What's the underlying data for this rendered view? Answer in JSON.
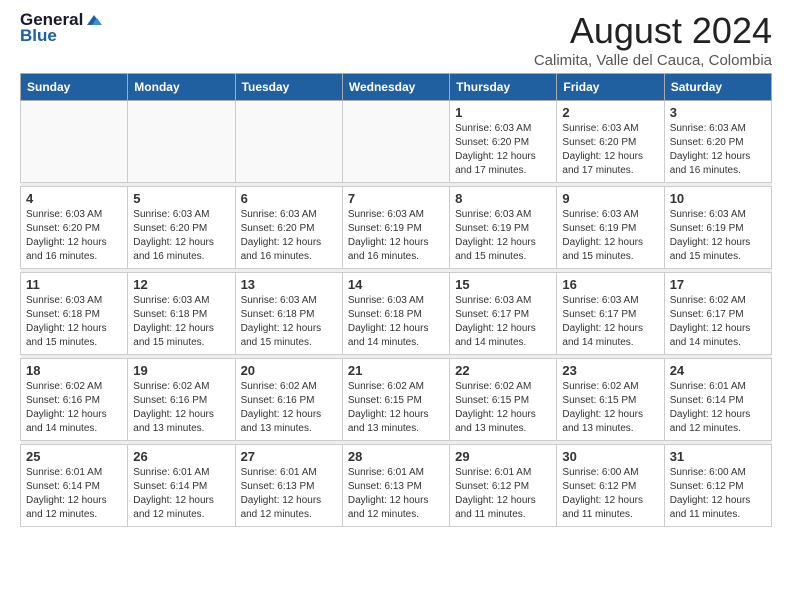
{
  "logo": {
    "general": "General",
    "blue": "Blue"
  },
  "header": {
    "title": "August 2024",
    "subtitle": "Calimita, Valle del Cauca, Colombia"
  },
  "days_of_week": [
    "Sunday",
    "Monday",
    "Tuesday",
    "Wednesday",
    "Thursday",
    "Friday",
    "Saturday"
  ],
  "weeks": [
    [
      {
        "day": "",
        "info": ""
      },
      {
        "day": "",
        "info": ""
      },
      {
        "day": "",
        "info": ""
      },
      {
        "day": "",
        "info": ""
      },
      {
        "day": "1",
        "info": "Sunrise: 6:03 AM\nSunset: 6:20 PM\nDaylight: 12 hours\nand 17 minutes."
      },
      {
        "day": "2",
        "info": "Sunrise: 6:03 AM\nSunset: 6:20 PM\nDaylight: 12 hours\nand 17 minutes."
      },
      {
        "day": "3",
        "info": "Sunrise: 6:03 AM\nSunset: 6:20 PM\nDaylight: 12 hours\nand 16 minutes."
      }
    ],
    [
      {
        "day": "4",
        "info": "Sunrise: 6:03 AM\nSunset: 6:20 PM\nDaylight: 12 hours\nand 16 minutes."
      },
      {
        "day": "5",
        "info": "Sunrise: 6:03 AM\nSunset: 6:20 PM\nDaylight: 12 hours\nand 16 minutes."
      },
      {
        "day": "6",
        "info": "Sunrise: 6:03 AM\nSunset: 6:20 PM\nDaylight: 12 hours\nand 16 minutes."
      },
      {
        "day": "7",
        "info": "Sunrise: 6:03 AM\nSunset: 6:19 PM\nDaylight: 12 hours\nand 16 minutes."
      },
      {
        "day": "8",
        "info": "Sunrise: 6:03 AM\nSunset: 6:19 PM\nDaylight: 12 hours\nand 15 minutes."
      },
      {
        "day": "9",
        "info": "Sunrise: 6:03 AM\nSunset: 6:19 PM\nDaylight: 12 hours\nand 15 minutes."
      },
      {
        "day": "10",
        "info": "Sunrise: 6:03 AM\nSunset: 6:19 PM\nDaylight: 12 hours\nand 15 minutes."
      }
    ],
    [
      {
        "day": "11",
        "info": "Sunrise: 6:03 AM\nSunset: 6:18 PM\nDaylight: 12 hours\nand 15 minutes."
      },
      {
        "day": "12",
        "info": "Sunrise: 6:03 AM\nSunset: 6:18 PM\nDaylight: 12 hours\nand 15 minutes."
      },
      {
        "day": "13",
        "info": "Sunrise: 6:03 AM\nSunset: 6:18 PM\nDaylight: 12 hours\nand 15 minutes."
      },
      {
        "day": "14",
        "info": "Sunrise: 6:03 AM\nSunset: 6:18 PM\nDaylight: 12 hours\nand 14 minutes."
      },
      {
        "day": "15",
        "info": "Sunrise: 6:03 AM\nSunset: 6:17 PM\nDaylight: 12 hours\nand 14 minutes."
      },
      {
        "day": "16",
        "info": "Sunrise: 6:03 AM\nSunset: 6:17 PM\nDaylight: 12 hours\nand 14 minutes."
      },
      {
        "day": "17",
        "info": "Sunrise: 6:02 AM\nSunset: 6:17 PM\nDaylight: 12 hours\nand 14 minutes."
      }
    ],
    [
      {
        "day": "18",
        "info": "Sunrise: 6:02 AM\nSunset: 6:16 PM\nDaylight: 12 hours\nand 14 minutes."
      },
      {
        "day": "19",
        "info": "Sunrise: 6:02 AM\nSunset: 6:16 PM\nDaylight: 12 hours\nand 13 minutes."
      },
      {
        "day": "20",
        "info": "Sunrise: 6:02 AM\nSunset: 6:16 PM\nDaylight: 12 hours\nand 13 minutes."
      },
      {
        "day": "21",
        "info": "Sunrise: 6:02 AM\nSunset: 6:15 PM\nDaylight: 12 hours\nand 13 minutes."
      },
      {
        "day": "22",
        "info": "Sunrise: 6:02 AM\nSunset: 6:15 PM\nDaylight: 12 hours\nand 13 minutes."
      },
      {
        "day": "23",
        "info": "Sunrise: 6:02 AM\nSunset: 6:15 PM\nDaylight: 12 hours\nand 13 minutes."
      },
      {
        "day": "24",
        "info": "Sunrise: 6:01 AM\nSunset: 6:14 PM\nDaylight: 12 hours\nand 12 minutes."
      }
    ],
    [
      {
        "day": "25",
        "info": "Sunrise: 6:01 AM\nSunset: 6:14 PM\nDaylight: 12 hours\nand 12 minutes."
      },
      {
        "day": "26",
        "info": "Sunrise: 6:01 AM\nSunset: 6:14 PM\nDaylight: 12 hours\nand 12 minutes."
      },
      {
        "day": "27",
        "info": "Sunrise: 6:01 AM\nSunset: 6:13 PM\nDaylight: 12 hours\nand 12 minutes."
      },
      {
        "day": "28",
        "info": "Sunrise: 6:01 AM\nSunset: 6:13 PM\nDaylight: 12 hours\nand 12 minutes."
      },
      {
        "day": "29",
        "info": "Sunrise: 6:01 AM\nSunset: 6:12 PM\nDaylight: 12 hours\nand 11 minutes."
      },
      {
        "day": "30",
        "info": "Sunrise: 6:00 AM\nSunset: 6:12 PM\nDaylight: 12 hours\nand 11 minutes."
      },
      {
        "day": "31",
        "info": "Sunrise: 6:00 AM\nSunset: 6:12 PM\nDaylight: 12 hours\nand 11 minutes."
      }
    ]
  ]
}
